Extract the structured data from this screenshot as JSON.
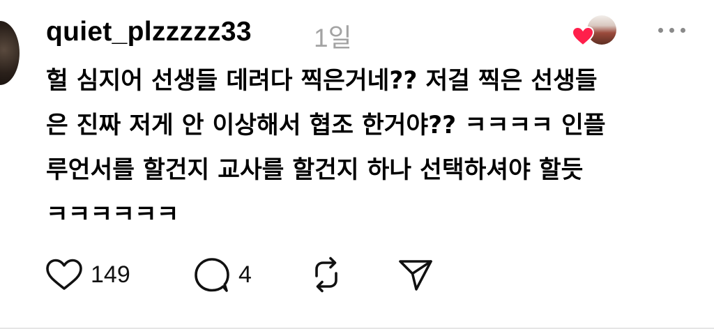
{
  "post": {
    "username": "quiet_plzzzzz33",
    "time": "1일",
    "text_lines": [
      "헐 심지어 선생들 데려다 찍은거네?? 저걸 찍은 선생들",
      "은 진짜 저게 안 이상해서 협조 한거야?? ㅋㅋㅋㅋ 인플",
      "루언서를 할건지 교사를 할건지 하나 선택하셔야 할듯",
      "ㅋㅋㅋㅋㅋㅋ"
    ]
  },
  "actions": {
    "likes": "149",
    "replies": "4"
  },
  "icons": {
    "like": "heart-outline-icon",
    "reply": "speech-bubble-icon",
    "repost": "repost-icon",
    "share": "paper-plane-icon",
    "reaction": "red-heart-icon",
    "more": "more-dots-icon"
  },
  "colors": {
    "heart_red": "#ff1f4b",
    "muted_text": "#a3a3a3",
    "icon_gray": "#111111"
  }
}
